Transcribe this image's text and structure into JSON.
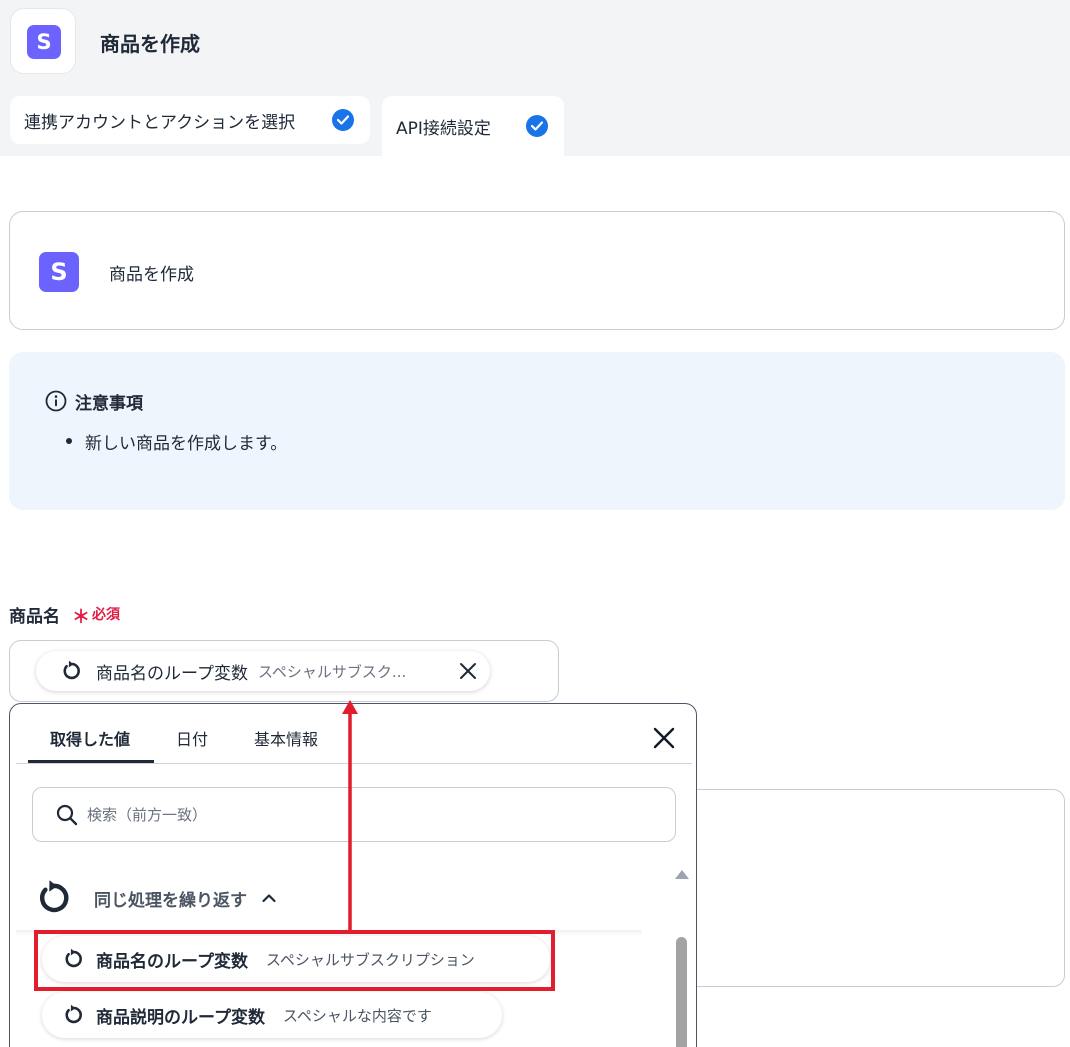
{
  "header": {
    "app_icon_letter": "S",
    "title": "商品を作成"
  },
  "tabs": [
    {
      "label": "連携アカウントとアクションを選択",
      "completed": true
    },
    {
      "label": "API接続設定",
      "completed": true,
      "active": true
    }
  ],
  "action_card": {
    "icon_letter": "S",
    "label": "商品を作成"
  },
  "notice": {
    "heading": "注意事項",
    "items": [
      "新しい商品を作成します。"
    ]
  },
  "field": {
    "label": "商品名",
    "required_star": "＊",
    "required_text": "必須",
    "chip": {
      "name": "商品名のループ変数",
      "sub": "スペシャルサブスク..."
    }
  },
  "picker": {
    "tabs": [
      "取得した値",
      "日付",
      "基本情報"
    ],
    "active_tab": 0,
    "search_placeholder": "検索（前方一致）",
    "group": {
      "label": "同じ処理を繰り返す",
      "expanded": true
    },
    "items": [
      {
        "name": "商品名のループ変数",
        "sub": "スペシャルサブスクリプション",
        "highlighted": true
      },
      {
        "name": "商品説明のループ変数",
        "sub": "スペシャルな内容です"
      }
    ]
  },
  "colors": {
    "accent_check": "#1a73e8",
    "app_icon": "#6c63ff",
    "required": "#e11d48",
    "annotation": "#e11d2e",
    "notice_bg": "#eef5fd"
  }
}
